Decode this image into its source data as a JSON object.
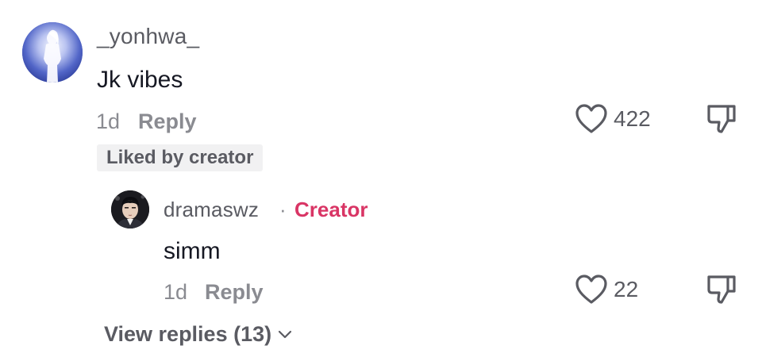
{
  "main_comment": {
    "username": "_yonhwa_",
    "text": "Jk vibes",
    "time": "1d",
    "reply_label": "Reply",
    "like_count": "422",
    "liked_by_label": "Liked by creator"
  },
  "reply_comment": {
    "username": "dramaswz",
    "separator": "·",
    "creator_label": "Creator",
    "text": "simm",
    "time": "1d",
    "reply_label": "Reply",
    "like_count": "22"
  },
  "view_replies_label": "View replies (13)",
  "icons": {
    "like": "heart-outline-icon",
    "dislike": "thumbs-down-icon",
    "expand": "chevron-down-icon"
  },
  "colors": {
    "creator_accent": "#d93565",
    "secondary_text": "#8a8b91",
    "badge_bg": "#f1f1f2"
  }
}
